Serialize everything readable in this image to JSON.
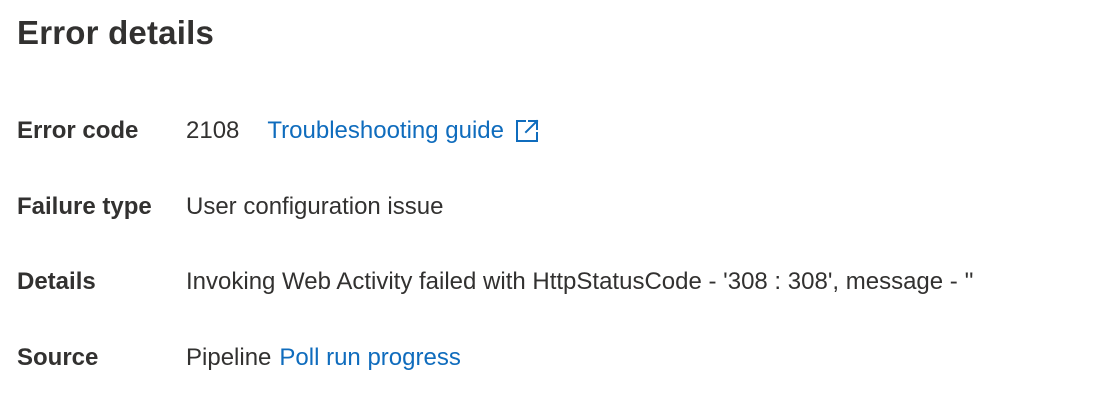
{
  "header": {
    "title": "Error details"
  },
  "rows": {
    "error_code": {
      "label": "Error code",
      "value": "2108",
      "link_label": "Troubleshooting guide",
      "link_icon": "external-link-icon"
    },
    "failure_type": {
      "label": "Failure type",
      "value": "User configuration issue"
    },
    "details": {
      "label": "Details",
      "value": "Invoking Web Activity failed with HttpStatusCode - '308 : 308', message - ''"
    },
    "source": {
      "label": "Source",
      "prefix": "Pipeline",
      "link_label": "Poll run progress"
    }
  },
  "colors": {
    "text": "#323130",
    "link": "#0f6cbd",
    "background": "#ffffff"
  }
}
